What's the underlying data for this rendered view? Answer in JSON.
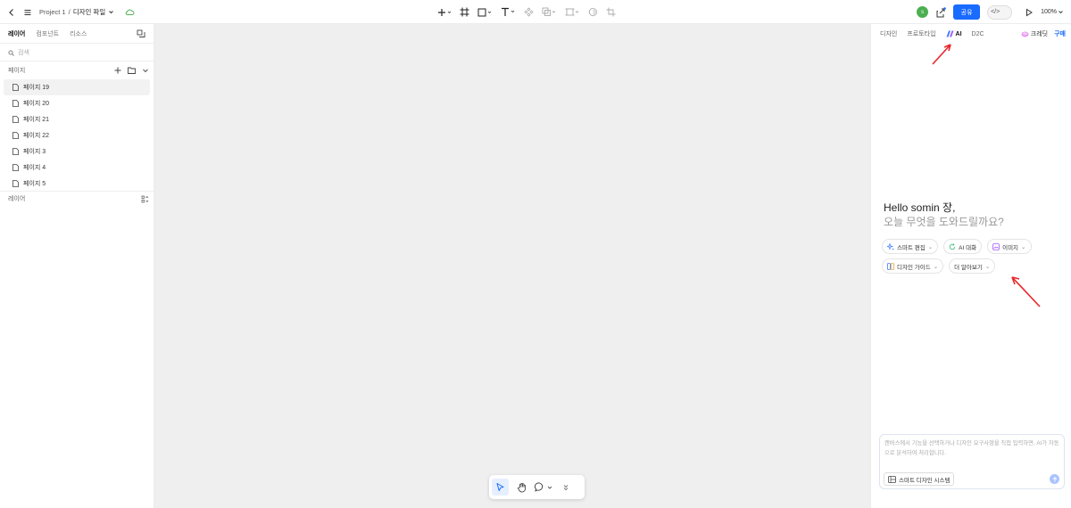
{
  "topbar": {
    "project": "Project 1",
    "separator": "/",
    "file_name": "디자인 파일",
    "avatar_letter": "s",
    "share_label": "공유",
    "code_label": "</>",
    "zoom": "100%"
  },
  "left_panel": {
    "tabs": [
      "레이어",
      "컴포넌트",
      "리소스"
    ],
    "search_placeholder": "검색",
    "pages_label": "페이지",
    "pages": [
      "페이지 19",
      "페이지 20",
      "페이지 21",
      "페이지 22",
      "페이지 3",
      "페이지 4",
      "페이지 5"
    ],
    "selected_page_index": 0,
    "layers_label": "레이어"
  },
  "right_panel": {
    "tabs": [
      "디자인",
      "프로토타입",
      "AI",
      "D2C"
    ],
    "active_tab": "AI",
    "credit_label": "크레딧",
    "buy_label": "구매",
    "greeting_line1": "Hello somin 장,",
    "greeting_line2": "오늘 무엇을 도와드릴까요?",
    "chips_row1": [
      "스마트 편집",
      "AI 대화",
      "이미지"
    ],
    "chips_row2": [
      "디자인 가이드",
      "더 알아보기"
    ],
    "prompt_placeholder": "캔버스에서 기능을 선택하거나 디자인 요구사항을 직접 입력하면, AI가 자동으로 분석하여 처리합니다.",
    "design_system_label": "스마트 디자인 시스템"
  },
  "colors": {
    "accent": "#1a6bff",
    "canvas": "#efefef",
    "annotation_arrow": "#e8252a"
  }
}
